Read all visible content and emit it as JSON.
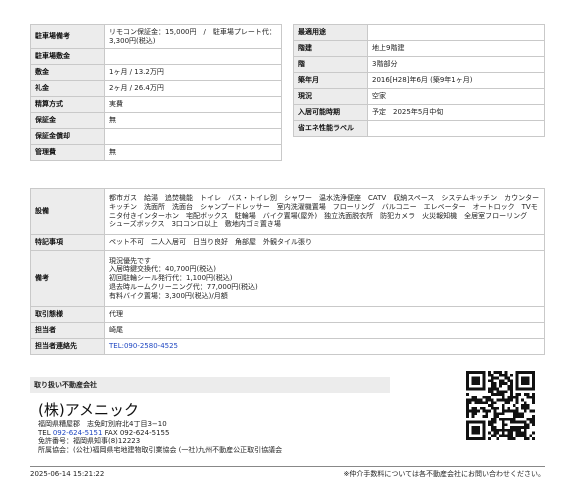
{
  "left_table": [
    {
      "label": "駐車場備考",
      "value": "リモコン保証金：15,000円　/　駐車場プレート代：3,300円(税込)"
    },
    {
      "label": "駐車場敷金",
      "value": ""
    },
    {
      "label": "敷金",
      "value": "1ヶ月 / 13.2万円"
    },
    {
      "label": "礼金",
      "value": "2ヶ月 / 26.4万円"
    },
    {
      "label": "精算方式",
      "value": "実費"
    },
    {
      "label": "保証金",
      "value": "無"
    },
    {
      "label": "保証金償却",
      "value": ""
    },
    {
      "label": "管理費",
      "value": "無"
    }
  ],
  "right_table": [
    {
      "label": "最適用途",
      "value": ""
    },
    {
      "label": "階建",
      "value": "地上9階建"
    },
    {
      "label": "階",
      "value": "3階部分"
    },
    {
      "label": "築年月",
      "value": "2016[H28]年6月 (築9年1ヶ月)"
    },
    {
      "label": "現況",
      "value": "空家"
    },
    {
      "label": "入居可能時期",
      "value": "予定　2025年5月中旬"
    },
    {
      "label": "省エネ性能ラベル",
      "value": ""
    }
  ],
  "bottom_table": {
    "equipment_label": "設備",
    "equipment_value": "都市ガス　給湯　追焚機能　トイレ　バス・トイレ別　シャワー　温水洗浄便座　CATV　収納スペース　システムキッチン　カウンターキッチン　洗面所　洗面台　シャンプードレッサー　室内洗濯機置場　フローリング　バルコニー　エレベーター　オートロック　TVモニタ付きインターホン　宅配ボックス　駐輪場　バイク置場(屋外)　独立洗面脱衣所　防犯カメラ　火災報知機　全居室フローリング　シューズボックス　3口コンロ以上　敷地内ゴミ置き場",
    "features_label": "特記事項",
    "features_value": "ペット不可　二人入居可　日当り良好　角部屋　外観タイル張り",
    "remarks_label": "備考",
    "remarks_lines": [
      "現況優先です",
      "入居時鍵交換代：40,700円(税込)",
      "初回駐輪シール発行代：1,100円(税込)",
      "退去時ルームクリーニング代：77,000円(税込)",
      "有料バイク置場：3,300円(税込)/月額"
    ],
    "transaction_label": "取引態様",
    "transaction_value": "代理",
    "staff_label": "担当者",
    "staff_value": "崎尾",
    "contact_label": "担当者連絡先",
    "contact_prefix": "TEL:",
    "contact_phone": "090-2580-4525"
  },
  "company": {
    "header": "取り扱い不動産会社",
    "name": "(株)アメニック",
    "address": "福岡県糟屋郡　志免町別府北4丁目3−10",
    "tel_prefix": "TEL ",
    "tel": "092-624-5151",
    "fax": " FAX 092-624-5155",
    "license": "免許番号：福岡県知事(8)12223",
    "association": "所属協会：(公社)福岡県宅地建物取引業協会 (一社)九州不動産公正取引協議会"
  },
  "footer": {
    "datetime": "2025-06-14 15:21:22",
    "note": "※仲介手数料については各不動産会社にお問い合わせください。"
  },
  "colors": {
    "link": "#1f47c2",
    "label_bg": "#ececec",
    "border": "#c9c9c9"
  },
  "qr_icon": "qr-code"
}
